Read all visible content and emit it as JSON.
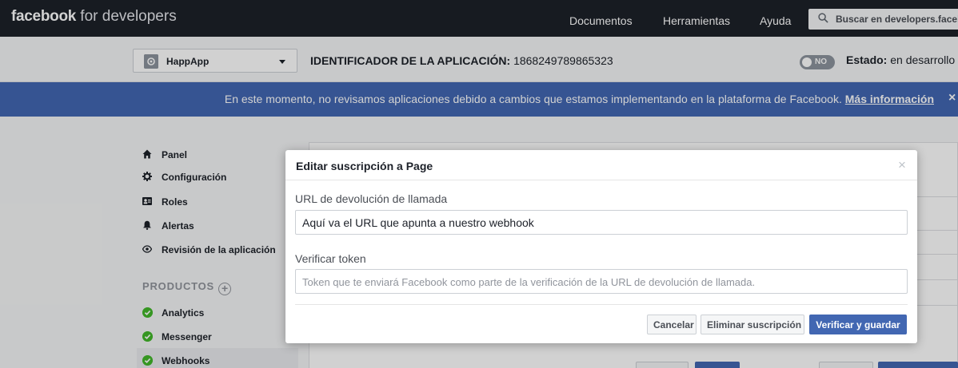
{
  "topbar": {
    "brand_bold": "facebook",
    "brand_light": " for developers",
    "nav": [
      "Documentos",
      "Herramientas",
      "Ayuda"
    ],
    "search_placeholder": "Buscar en developers.facebook.com"
  },
  "appbar": {
    "app_name": "HappApp",
    "app_id_label": "IDENTIFICADOR DE LA APLICACIÓN:",
    "app_id_value": " 1868249789865323",
    "toggle_label": "NO",
    "status_label": "Estado:",
    "status_value": " en desarrollo"
  },
  "banner": {
    "text": "En este momento, no revisamos aplicaciones debido a cambios que estamos implementando en la plataforma de Facebook. ",
    "link": "Más información",
    "close": "×"
  },
  "sidebar": {
    "items": [
      {
        "label": "Panel",
        "icon": "home-icon"
      },
      {
        "label": "Configuración",
        "icon": "gear-icon"
      },
      {
        "label": "Roles",
        "icon": "roles-icon"
      },
      {
        "label": "Alertas",
        "icon": "bell-icon"
      },
      {
        "label": "Revisión de la aplicación",
        "icon": "eye-icon"
      }
    ],
    "products_header": "PRODUCTOS",
    "products_add": "+",
    "products": [
      {
        "label": "Analytics"
      },
      {
        "label": "Messenger"
      },
      {
        "label": "Webhooks",
        "active": true
      }
    ]
  },
  "modal": {
    "title": "Editar suscripción a Page",
    "close": "×",
    "callback_label": "URL de devolución de llamada",
    "callback_value": "Aquí va el URL que apunta a nuestro webhook",
    "token_label": "Verificar token",
    "token_placeholder": "Token que te enviará Facebook como parte de la verificación de la URL de devolución de llamada.",
    "cancel": "Cancelar",
    "delete": "Eliminar suscripción",
    "save": "Verificar y guardar"
  },
  "colors": {
    "topbar": "#1d2129",
    "banner": "#4267b2",
    "primary": "#4267b2",
    "success": "#42b72a"
  }
}
